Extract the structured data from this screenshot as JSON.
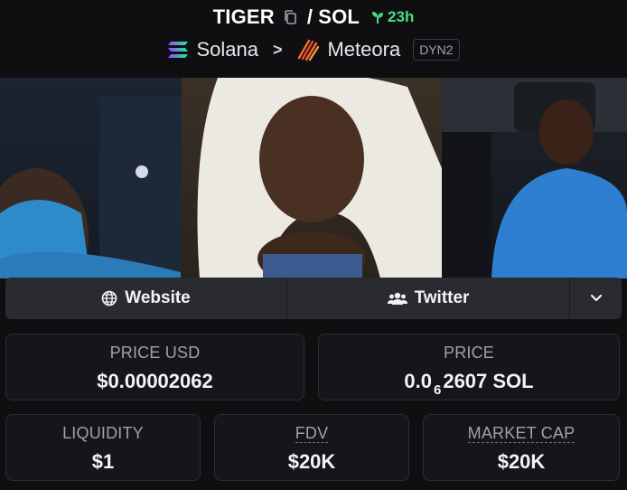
{
  "header": {
    "token_symbol": "TIGER",
    "separator": "/",
    "quote_symbol": "SOL",
    "age": "23h",
    "chain": "Solana",
    "chevron": ">",
    "dex": "Meteora",
    "pool_badge": "DYN2"
  },
  "links": {
    "website_label": "Website",
    "twitter_label": "Twitter"
  },
  "stats": {
    "price_usd_label": "PRICE USD",
    "price_usd_value": "$0.00002062",
    "price_label": "PRICE",
    "price_prefix": "0.0",
    "price_zero_count": "6",
    "price_suffix": "2607 SOL",
    "liquidity_label": "LIQUIDITY",
    "liquidity_value": "$1",
    "fdv_label": "FDV",
    "fdv_value": "$20K",
    "market_cap_label": "MARKET CAP",
    "market_cap_value": "$20K"
  },
  "colors": {
    "background": "#0f0f12",
    "card": "#15151a",
    "link_bar": "#2a2a31",
    "age_green": "#4ade80",
    "solana_gradient": [
      "#9945ff",
      "#14f195"
    ],
    "meteora_orange": "#f97316"
  },
  "icons": {
    "copy": "copy-icon",
    "age": "sprout-icon",
    "solana": "solana-logo-icon",
    "meteora": "meteora-logo-icon",
    "website": "globe-icon",
    "twitter": "users-icon",
    "more": "chevron-down-icon"
  }
}
